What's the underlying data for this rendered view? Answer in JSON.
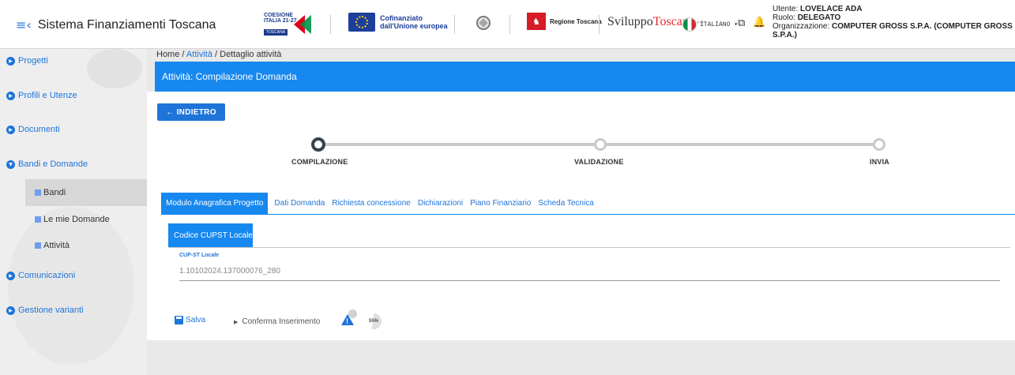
{
  "header": {
    "app_title": "Sistema Finanziamenti Toscana",
    "coesione_lines": "COESIONE\nITALIA 21-27",
    "coesione_tag": "TOSCANA",
    "eu_text": "Cofinanziato\ndall'Unione europea",
    "region_text": "Regione Toscana",
    "sviluppo_part1": "Sviluppo",
    "sviluppo_part2": "Toscana",
    "sviluppo_spa": "S.p.A.",
    "language": "ITALIANO",
    "user_label": "Utente:",
    "user_name": "LOVELACE ADA",
    "role_label": "Ruolo:",
    "role_value": "DELEGATO",
    "org_label": "Organizzazione:",
    "org_value": "COMPUTER GROSS S.P.A. (COMPUTER GROSS S.P.A.)"
  },
  "sidebar": {
    "items": [
      {
        "label": "Progetti"
      },
      {
        "label": "Profili e Utenze"
      },
      {
        "label": "Documenti"
      },
      {
        "label": "Bandi e Domande"
      },
      {
        "label": "Comunicazioni"
      },
      {
        "label": "Gestione varianti"
      }
    ],
    "sub_items": [
      {
        "label": "Bandi"
      },
      {
        "label": "Le mie Domande"
      },
      {
        "label": "Attività"
      }
    ]
  },
  "breadcrumb": {
    "home": "Home",
    "sep": "/",
    "section": "Attività",
    "current": "Dettaglio attività"
  },
  "page": {
    "title": "Attività: Compilazione Domanda",
    "back_button": "← INDIETRO"
  },
  "stepper": {
    "steps": [
      "COMPILAZIONE",
      "VALIDAZIONE",
      "INVIA"
    ],
    "active_index": 0
  },
  "tabs": [
    "Modulo Anagrafica Progetto",
    "Dati Domanda",
    "Richiesta concessione",
    "Dichiarazioni",
    "Piano Finanziario",
    "Scheda Tecnica"
  ],
  "subtab": "Codice CUPST Locale",
  "field": {
    "label": "CUP-ST Locale",
    "value": "1.10102024.137000076_280"
  },
  "actions": {
    "save": "Salva",
    "confirm": "Conferma Inserimento",
    "progress_percent": "55%",
    "progress_value": 55
  },
  "colors": {
    "primary": "#1688ef",
    "link": "#1f74d9"
  }
}
